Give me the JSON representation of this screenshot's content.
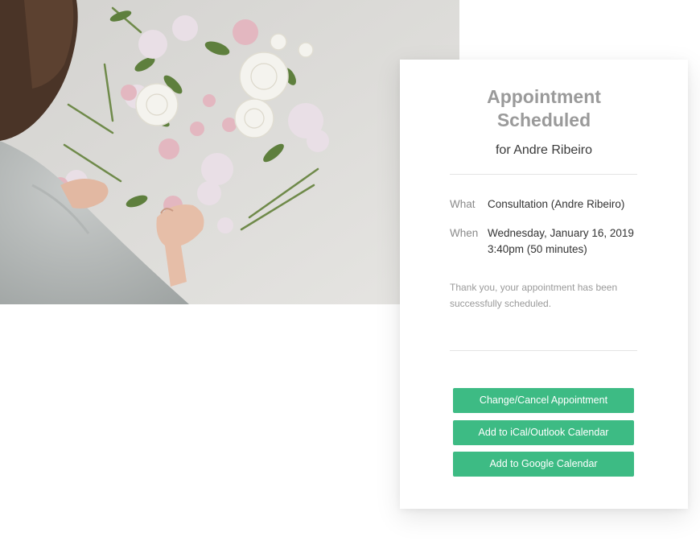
{
  "card": {
    "title_line1": "Appointment",
    "title_line2": "Scheduled",
    "subtitle": "for Andre Ribeiro",
    "what_label": "What",
    "what_value": "Consultation (Andre Ribeiro)",
    "when_label": "When",
    "when_value": "Wednesday, January 16, 2019 3:40pm (50 minutes)",
    "note": "Thank you, your appointment has been successfully scheduled."
  },
  "buttons": {
    "change_cancel": "Change/Cancel Appointment",
    "ical_outlook": "Add to iCal/Outlook Calendar",
    "google": "Add to Google Calendar"
  },
  "colors": {
    "accent": "#3dbb84",
    "title": "#9a9a9a",
    "text": "#333333"
  }
}
